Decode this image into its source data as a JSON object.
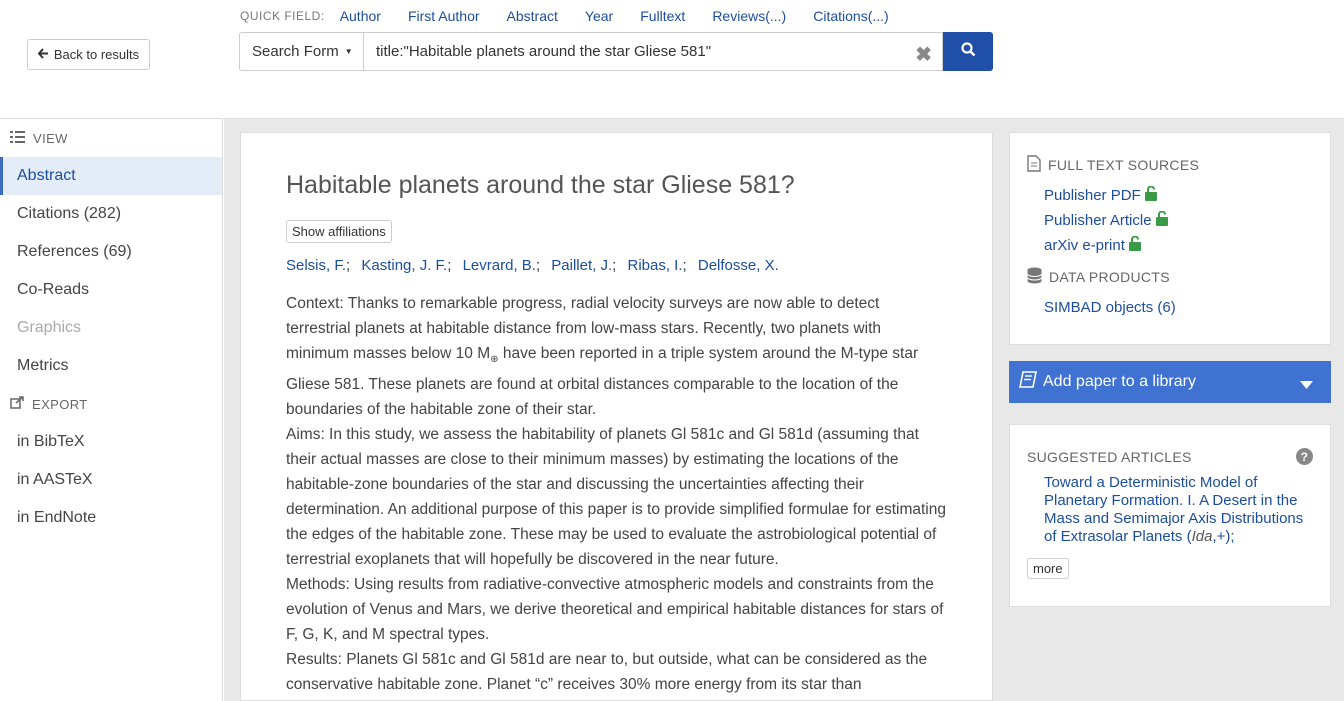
{
  "header": {
    "back_label": "Back to results",
    "quick_field_label": "QUICK FIELD:",
    "quick_fields": [
      "Author",
      "First Author",
      "Abstract",
      "Year",
      "Fulltext",
      "Reviews(...)",
      "Citations(...)"
    ],
    "search_form_label": "Search Form",
    "search_value": "title:\"Habitable planets around the star Gliese 581\""
  },
  "sidebar": {
    "view_label": "VIEW",
    "view_items": [
      "Abstract",
      "Citations (282)",
      "References (69)",
      "Co-Reads",
      "Graphics",
      "Metrics"
    ],
    "export_label": "EXPORT",
    "export_items": [
      "in BibTeX",
      "in AASTeX",
      "in EndNote"
    ]
  },
  "article": {
    "title": "Habitable planets around the star Gliese 581?",
    "affiliations_label": "Show affiliations",
    "authors": [
      "Selsis, F.",
      "Kasting, J. F.",
      "Levrard, B.",
      "Paillet, J.",
      "Ribas, I.",
      "Delfosse, X."
    ],
    "abstract": {
      "context_a": "Context: Thanks to remarkable progress, radial velocity surveys are now able to detect terrestrial planets at habitable distance from low-mass stars. Recently, two planets with minimum masses below 10 M",
      "context_sub": "⊕",
      "context_b": " have been reported in a triple system around the M-type star Gliese 581. These planets are found at orbital distances comparable to the location of the boundaries of the habitable zone of their star.",
      "aims": "Aims: In this study, we assess the habitability of planets Gl 581c and Gl 581d (assuming that their actual masses are close to their minimum masses) by estimating the locations of the habitable-zone boundaries of the star and discussing the uncertainties affecting their determination. An additional purpose of this paper is to provide simplified formulae for estimating the edges of the habitable zone. These may be used to evaluate the astrobiological potential of terrestrial exoplanets that will hopefully be discovered in the near future.",
      "methods": "Methods: Using results from radiative-convective atmospheric models and constraints from the evolution of Venus and Mars, we derive theoretical and empirical habitable distances for stars of F, G, K, and M spectral types.",
      "results": "Results: Planets Gl 581c and Gl 581d are near to, but outside, what can be considered as the conservative habitable zone. Planet “c” receives 30% more energy from its star than"
    }
  },
  "full_text": {
    "heading": "FULL TEXT SOURCES",
    "sources": [
      "Publisher PDF",
      "Publisher Article",
      "arXiv e-print"
    ],
    "data_heading": "DATA PRODUCTS",
    "data_items": [
      "SIMBAD objects (6)"
    ]
  },
  "library": {
    "label": "Add paper to a library"
  },
  "suggested": {
    "heading": "SUGGESTED ARTICLES",
    "title": "Toward a Deterministic Model of Planetary Formation. I. A Desert in the Mass and Semimajor Axis Distributions of Extrasolar Planets",
    "open_paren": " (",
    "authors_abbrev": "Ida",
    "suffix": ",+);",
    "more_label": "more"
  },
  "colors": {
    "brand": "#1f4fa7",
    "link": "#1c4ea0",
    "library_bar": "#3f72d1",
    "open_access": "#3a9a46"
  },
  "icons": {
    "back": "arrow-left-icon",
    "search": "magnifier-icon",
    "clear": "x-icon",
    "view": "list-icon",
    "export": "share-icon",
    "full_text": "document-icon",
    "data": "database-icon",
    "library": "book-icon",
    "unlock": "unlock-icon",
    "help": "question-icon"
  }
}
